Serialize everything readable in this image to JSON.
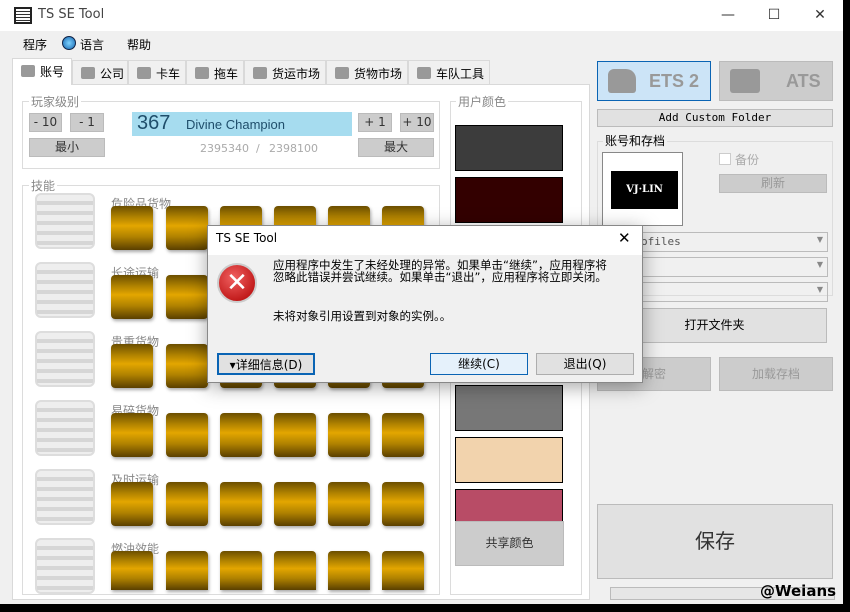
{
  "window": {
    "title": "TS SE Tool",
    "minimize": "—",
    "maximize": "☐",
    "close": "✕"
  },
  "menu": {
    "items": [
      "程序",
      "语言",
      "帮助"
    ]
  },
  "tabs": [
    {
      "label": "账号",
      "icon": "account-icon"
    },
    {
      "label": "公司",
      "icon": "company-icon"
    },
    {
      "label": "卡车",
      "icon": "truck-icon"
    },
    {
      "label": "拖车",
      "icon": "trailer-icon"
    },
    {
      "label": "货运市场",
      "icon": "freight-market-icon"
    },
    {
      "label": "货物市场",
      "icon": "cargo-market-icon"
    },
    {
      "label": "车队工具",
      "icon": "convoy-tools-icon"
    }
  ],
  "player_level": {
    "title": "玩家级别",
    "minus10": "- 10",
    "minus1": "- 1",
    "min": "最小",
    "plus1": "+ 1",
    "plus10": "+ 10",
    "max": "最大",
    "level": "367",
    "rank": "Divine Champion",
    "xp_current": "2395340",
    "xp_sep": "/",
    "xp_next": "2398100"
  },
  "skills": {
    "title": "技能",
    "rows": [
      {
        "label": "危险品货物",
        "level": 6
      },
      {
        "label": "长途运输",
        "level": 6
      },
      {
        "label": "贵重货物",
        "level": 6
      },
      {
        "label": "易碎货物",
        "level": 6
      },
      {
        "label": "及时运输",
        "level": 6
      },
      {
        "label": "燃油效能",
        "level": 6
      }
    ]
  },
  "user_colors": {
    "title": "用户颜色",
    "swatches": [
      "#3c3c3c",
      "#330000",
      "#777777",
      "#f2d3ad",
      "#b84c66"
    ],
    "share": "共享颜色"
  },
  "game": {
    "ets2": "ETS 2",
    "ats": "ATS",
    "selected": "ETS 2",
    "accent": "#cce4f7"
  },
  "add_custom_folder": "Add Custom Folder",
  "profiles": {
    "title": "账号和存档",
    "logo_text": "VJ·LIN",
    "backup": "备份",
    "refresh": "刷新",
    "profile_value": "ofiles",
    "open_folder": "打开文件夹",
    "decrypt": "解密",
    "load_save": "加载存档"
  },
  "save": "保存",
  "watermark": "@Weians",
  "dialog": {
    "title": "TS SE Tool",
    "close": "✕",
    "message": "应用程序中发生了未经处理的异常。如果单击“继续”，应用程序将忽略此错误并尝试继续。如果单击“退出”，应用程序将立即关闭。",
    "detail": "未将对象引用设置到对象的实例。。",
    "details_btn": "▾详细信息(D)",
    "continue_btn": "继续(C)",
    "quit_btn": "退出(Q)"
  }
}
